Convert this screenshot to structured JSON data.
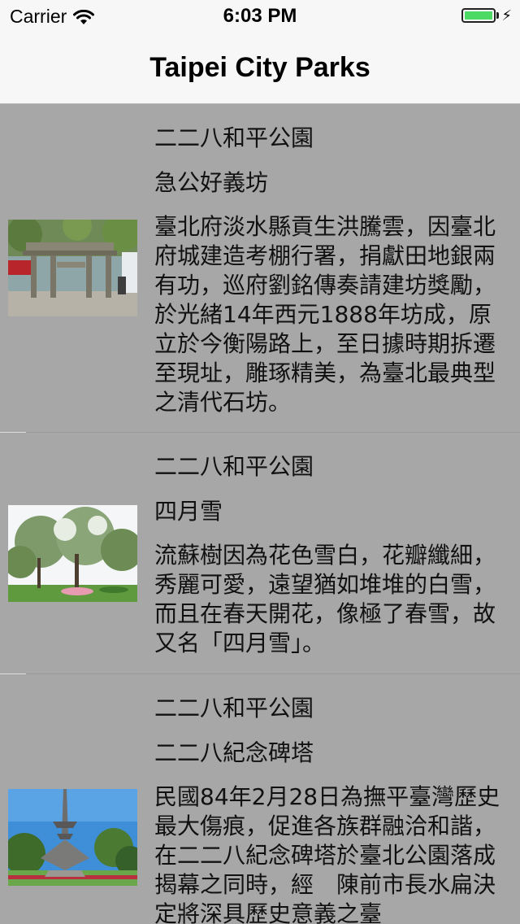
{
  "status_bar": {
    "carrier": "Carrier",
    "time": "6:03 PM",
    "battery_level": 1.0
  },
  "nav": {
    "title": "Taipei City Parks"
  },
  "items": [
    {
      "park": "二二八和平公園",
      "name": "急公好義坊",
      "description": "臺北府淡水縣貢生洪騰雲，因臺北府城建造考棚行署，捐獻田地銀兩有功，巡府劉銘傳奏請建坊獎勵，於光緒14年西元1888年坊成，原立於今衡陽路上，至日據時期拆遷至現址，雕琢精美，為臺北最典型之清代石坊。",
      "image": "stone-archway-photo"
    },
    {
      "park": "二二八和平公園",
      "name": "四月雪",
      "description": "流蘇樹因為花色雪白，花瓣纖細，秀麗可愛，遠望猶如堆堆的白雪，而且在春天開花，像極了春雪，故又名「四月雪」。",
      "image": "flowering-tree-photo"
    },
    {
      "park": "二二八和平公園",
      "name": "二二八紀念碑塔",
      "description": "民國84年2月28日為撫平臺灣歷史最大傷痕，促進各族群融洽和諧，在二二八紀念碑塔於臺北公園落成揭幕之同時，經　陳前市長水扁決定將深具歷史意義之臺",
      "image": "memorial-monument-photo"
    }
  ]
}
